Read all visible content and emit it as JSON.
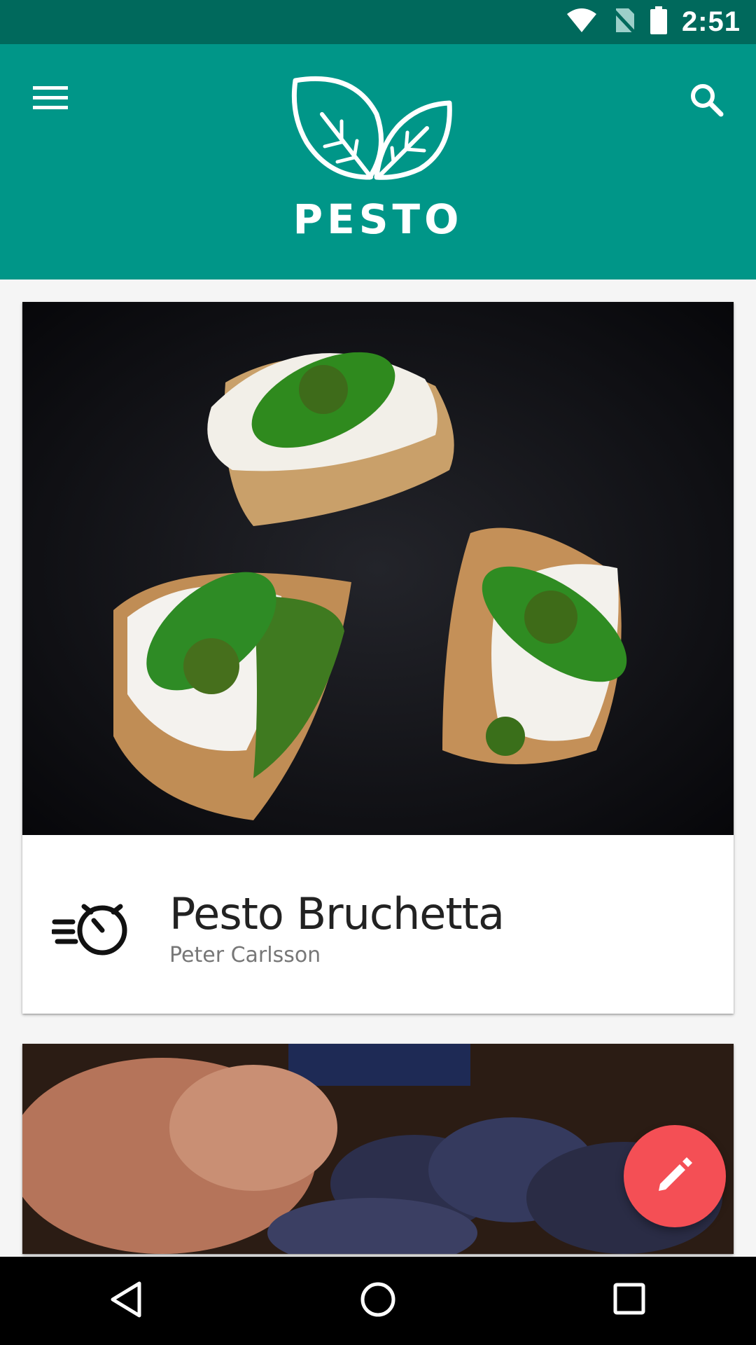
{
  "status_bar": {
    "time": "2:51",
    "icons": [
      "wifi-icon",
      "no-sim-icon",
      "battery-icon"
    ]
  },
  "app_bar": {
    "logo_text": "PESTO",
    "menu_icon": "menu-icon",
    "search_icon": "search-icon",
    "background_color": "#009688"
  },
  "cards": [
    {
      "title": "Pesto Bruchetta",
      "author": "Peter Carlsson",
      "icon": "quick-timer-icon"
    }
  ],
  "fab": {
    "icon": "pencil-icon",
    "color": "#f44f55"
  },
  "nav_bar": {
    "buttons": [
      "back-icon",
      "home-icon",
      "recents-icon"
    ]
  }
}
